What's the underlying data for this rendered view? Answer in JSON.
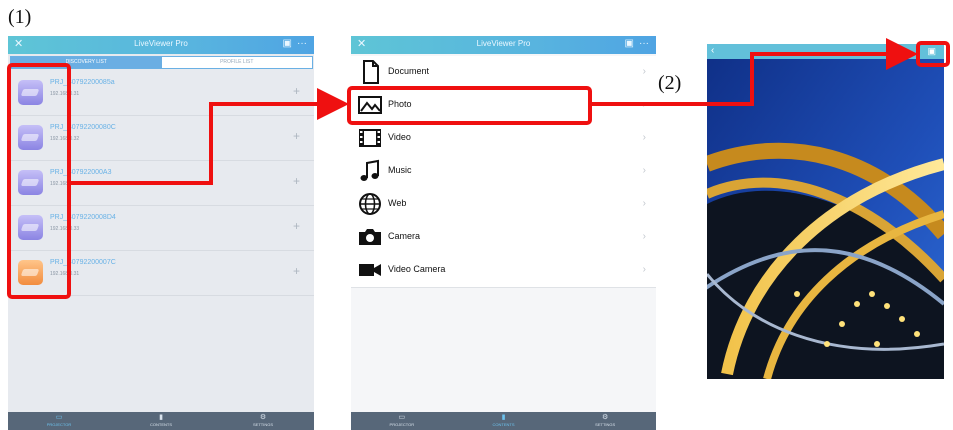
{
  "steps": {
    "step1": "(1)",
    "step2": "(2)"
  },
  "screen1": {
    "app_title": "LiveViewer Pro",
    "tabs": [
      "DISCOVERY LIST",
      "PROFILE LIST"
    ],
    "projectors": [
      {
        "name": "PRJ_B0792200085a",
        "ip": "192.168.0.31",
        "color": "purple"
      },
      {
        "name": "PRJ_B0792200080C",
        "ip": "192.168.0.32",
        "color": "purple"
      },
      {
        "name": "PRJ_B07922000A3",
        "ip": "192.168.0.41",
        "color": "purple"
      },
      {
        "name": "PRJ_B079220008D4",
        "ip": "192.168.0.33",
        "color": "purple"
      },
      {
        "name": "PRJ_B0792200007C",
        "ip": "192.168.0.31",
        "color": "orange"
      }
    ],
    "add_symbol": "+",
    "bottom_tabs": [
      "PROJECTOR",
      "CONTENTS",
      "SETTINGS"
    ]
  },
  "screen2": {
    "app_title": "LiveViewer Pro",
    "items": [
      {
        "label": "Document",
        "icon": "document-icon"
      },
      {
        "label": "Photo",
        "icon": "photo-icon"
      },
      {
        "label": "Video",
        "icon": "film-icon"
      },
      {
        "label": "Music",
        "icon": "music-note-icon"
      },
      {
        "label": "Web",
        "icon": "globe-icon"
      },
      {
        "label": "Camera",
        "icon": "camera-icon"
      },
      {
        "label": "Video Camera",
        "icon": "video-camera-icon"
      }
    ],
    "chevron": "›",
    "bottom_tabs": [
      "PROJECTOR",
      "CONTENTS",
      "SETTINGS"
    ]
  },
  "screen3": {
    "back": "‹"
  },
  "colors": {
    "accent": "#5ec5d6",
    "callout": "#ef1010",
    "tabbar": "#576779"
  }
}
